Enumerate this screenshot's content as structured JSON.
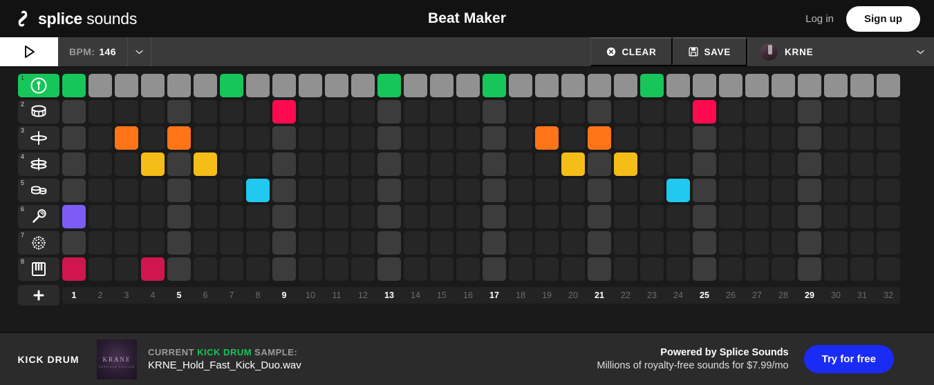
{
  "header": {
    "brand_bold": "splice",
    "brand_light": " sounds",
    "brand_icon": "splice-logo-icon",
    "title": "Beat Maker",
    "login_label": "Log in",
    "signup_label": "Sign up"
  },
  "toolbar": {
    "play_icon": "play-icon",
    "bpm_label": "BPM:",
    "bpm_value": "146",
    "bpm_dropdown_icon": "chevron-down-icon",
    "clear_label": "CLEAR",
    "clear_icon": "x-circle-icon",
    "save_label": "SAVE",
    "save_icon": "floppy-disk-icon",
    "user_name": "KRNE",
    "user_avatar": "user-avatar",
    "user_dropdown_icon": "chevron-down-icon"
  },
  "sequencer": {
    "steps": 32,
    "beat_steps": [
      1,
      5,
      9,
      13,
      17,
      21,
      25,
      29
    ],
    "step_numbers": [
      1,
      2,
      3,
      4,
      5,
      6,
      7,
      8,
      9,
      10,
      11,
      12,
      13,
      14,
      15,
      16,
      17,
      18,
      19,
      20,
      21,
      22,
      23,
      24,
      25,
      26,
      27,
      28,
      29,
      30,
      31,
      32
    ],
    "add_track_icon": "plus-icon",
    "selected_track": 1,
    "tracks": [
      {
        "num": "1",
        "name": "kick-drum",
        "icon": "kick-drum-icon",
        "color": "#16c65a",
        "selected": true,
        "active_steps": [
          1,
          7,
          13,
          17,
          23
        ]
      },
      {
        "num": "2",
        "name": "snare",
        "icon": "snare-drum-icon",
        "color": "#ff0a4f",
        "selected": false,
        "active_steps": [
          9,
          25
        ]
      },
      {
        "num": "3",
        "name": "hi-hat",
        "icon": "hi-hat-icon",
        "color": "#ff7417",
        "selected": false,
        "active_steps": [
          3,
          5,
          19,
          21
        ]
      },
      {
        "num": "4",
        "name": "open-hat",
        "icon": "open-hat-icon",
        "color": "#f5bd17",
        "selected": false,
        "active_steps": [
          4,
          6,
          20,
          22
        ]
      },
      {
        "num": "5",
        "name": "percussion",
        "icon": "percussion-icon",
        "color": "#21c8f0",
        "selected": false,
        "active_steps": [
          8,
          24
        ]
      },
      {
        "num": "6",
        "name": "vocal",
        "icon": "microphone-icon",
        "color": "#7c5cf5",
        "selected": false,
        "active_steps": [
          1
        ]
      },
      {
        "num": "7",
        "name": "noise",
        "icon": "noise-icon",
        "color": "#9b9b9b",
        "selected": false,
        "active_steps": []
      },
      {
        "num": "8",
        "name": "keys",
        "icon": "piano-keys-icon",
        "color": "#d0164f",
        "selected": false,
        "active_steps": [
          1,
          4
        ]
      }
    ]
  },
  "bottom": {
    "instrument_label": "KICK DRUM",
    "artwork_title": "KRANE",
    "artwork_subtitle": "PARTICLE EDITION",
    "current_prefix": "CURRENT ",
    "current_highlight": "KICK DRUM",
    "current_suffix": " SAMPLE:",
    "sample_filename": "KRNE_Hold_Fast_Kick_Duo.wav",
    "promo_line1": "Powered by Splice Sounds",
    "promo_line2": "Millions of royalty-free sounds for $7.99/mo",
    "try_label": "Try for free"
  },
  "colors": {
    "accent_green": "#16c65a",
    "promo_blue": "#1a2bf5",
    "background": "#1a1a1a"
  }
}
